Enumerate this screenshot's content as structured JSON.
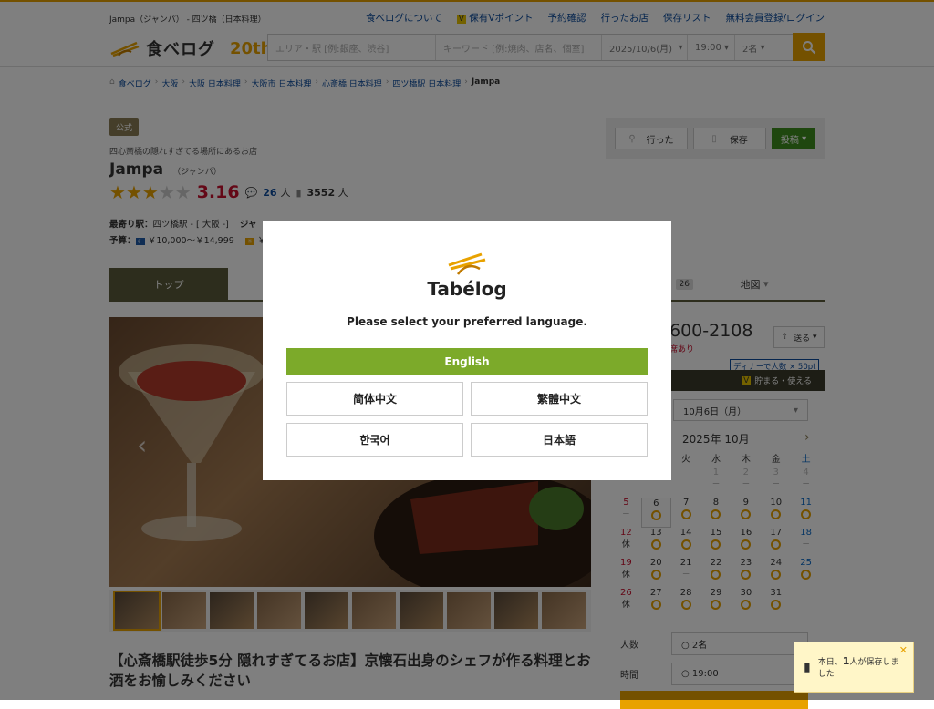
{
  "header": {
    "crumb_top": "Jampa（ジャンパ） - 四ツ橋（日本料理）",
    "links": [
      "食べログについて",
      "保有Vポイント",
      "予約確認",
      "行ったお店",
      "保存リスト",
      "無料会員登録/ログイン"
    ],
    "logo_text": "食べログ",
    "anniv_text": "20th",
    "search": {
      "area_placeholder": "エリア・駅 [例:銀座、渋谷]",
      "keyword_placeholder": "キーワード [例:焼肉、店名、個室]",
      "date": "2025/10/6(月)",
      "time": "19:00",
      "people": "2名"
    }
  },
  "breadcrumb": [
    "食べログ",
    "大阪",
    "大阪 日本料理",
    "大阪市 日本料理",
    "心斎橋 日本料理",
    "四ツ橋駅 日本料理",
    "Jampa"
  ],
  "shop": {
    "badge": "公式",
    "catch": "四心斎橋の隠れすぎてる場所にあるお店",
    "name": "Jampa",
    "kana": "（ジャンパ）",
    "stars": 3,
    "score": "3.16",
    "reviews_count": "26",
    "reviews_unit": "人",
    "saves_count": "3552",
    "saves_unit": "人",
    "station_label": "最寄り駅：",
    "station": "四ツ橋駅 - [ 大阪 -]",
    "genre_label": "ジャ",
    "budget_label": "予算：",
    "budget_dinner": "￥10,000～￥14,999",
    "budget_lunch": "￥1"
  },
  "actions": {
    "went": "行った",
    "save": "保存",
    "post": "投稿"
  },
  "tabs": [
    "トップ",
    "",
    "",
    "",
    "26",
    "地図"
  ],
  "description": "【心斎橋駅徒歩5分 隠れすぎてるお店】京懐石出身のシェフが作る料理とお酒をお愉しみください",
  "sidebar": {
    "phone": "600-2108",
    "send": "送る",
    "reserved_note": "席あり",
    "points_badge": "ディナーで人数 × 50pt",
    "vbar": "貯まる・使える",
    "date_select": "10月6日（月）",
    "cal_title": "2025年 10月",
    "weekdays": [
      "",
      "",
      "火",
      "水",
      "木",
      "金",
      "土"
    ],
    "party_label": "人数",
    "party_value": "○ 2名",
    "time_label": "時間",
    "time_value": "○ 19:00"
  },
  "calendar": [
    [
      {
        "d": "",
        "s": ""
      },
      {
        "d": "",
        "s": ""
      },
      {
        "d": "",
        "s": ""
      },
      {
        "d": "1",
        "s": "dash"
      },
      {
        "d": "2",
        "s": "dash"
      },
      {
        "d": "3",
        "s": "dash"
      },
      {
        "d": "4",
        "s": "dash"
      }
    ],
    [
      {
        "d": "5",
        "s": "dash"
      },
      {
        "d": "6",
        "s": "ring"
      },
      {
        "d": "7",
        "s": "ring"
      },
      {
        "d": "8",
        "s": "ring"
      },
      {
        "d": "9",
        "s": "ring"
      },
      {
        "d": "10",
        "s": "ring"
      },
      {
        "d": "11",
        "s": "ring"
      }
    ],
    [
      {
        "d": "12",
        "s": "休"
      },
      {
        "d": "13",
        "s": "ring"
      },
      {
        "d": "14",
        "s": "ring"
      },
      {
        "d": "15",
        "s": "ring"
      },
      {
        "d": "16",
        "s": "ring"
      },
      {
        "d": "17",
        "s": "ring"
      },
      {
        "d": "18",
        "s": "dash"
      }
    ],
    [
      {
        "d": "19",
        "s": "休"
      },
      {
        "d": "20",
        "s": "ring"
      },
      {
        "d": "21",
        "s": "dash"
      },
      {
        "d": "22",
        "s": "ring"
      },
      {
        "d": "23",
        "s": "ring"
      },
      {
        "d": "24",
        "s": "ring"
      },
      {
        "d": "25",
        "s": "ring"
      }
    ],
    [
      {
        "d": "26",
        "s": "休"
      },
      {
        "d": "27",
        "s": "ring"
      },
      {
        "d": "28",
        "s": "ring"
      },
      {
        "d": "29",
        "s": "ring"
      },
      {
        "d": "30",
        "s": "ring"
      },
      {
        "d": "31",
        "s": "ring"
      },
      {
        "d": "",
        "s": ""
      }
    ]
  ],
  "modal": {
    "brand": "Tabélog",
    "prompt": "Please select your preferred language.",
    "english": "English",
    "simplified": "简体中文",
    "traditional": "繁體中文",
    "korean": "한국어",
    "japanese": "日本語"
  },
  "toast": {
    "pre": "本日、",
    "count": "1",
    "post": "人が保存しました"
  },
  "colors": {
    "accent": "#e8a200",
    "english_button": "#7caa2a",
    "score": "#c8102e"
  }
}
